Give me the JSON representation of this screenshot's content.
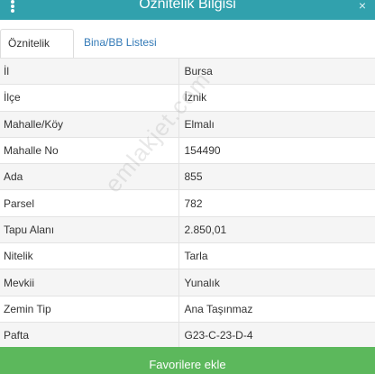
{
  "header": {
    "title": "Öznitelik Bilgisi",
    "close_glyph": "×"
  },
  "tabs": [
    {
      "label": "Öznitelik Bilgisi",
      "active": true
    },
    {
      "label": "Bina/BB Listesi",
      "active": false
    }
  ],
  "rows": [
    {
      "key": "İl",
      "value": "Bursa"
    },
    {
      "key": "İlçe",
      "value": "İznik"
    },
    {
      "key": "Mahalle/Köy",
      "value": "Elmalı"
    },
    {
      "key": "Mahalle No",
      "value": "154490"
    },
    {
      "key": "Ada",
      "value": "855"
    },
    {
      "key": "Parsel",
      "value": "782"
    },
    {
      "key": "Tapu Alanı",
      "value": "2.850,01"
    },
    {
      "key": "Nitelik",
      "value": "Tarla"
    },
    {
      "key": "Mevkii",
      "value": "Yunalık"
    },
    {
      "key": "Zemin Tip",
      "value": "Ana Taşınmaz"
    },
    {
      "key": "Pafta",
      "value": "G23-C-23-D-4"
    }
  ],
  "watermark": "emlakjet.com",
  "footer": {
    "favorite_label": "Favorilere ekle"
  },
  "colors": {
    "header_bg": "#31a1ad",
    "tab_link": "#337ab7",
    "button_bg": "#5cb85c"
  },
  "icons": {
    "menu": "menu-dots-icon",
    "close": "close-icon"
  }
}
